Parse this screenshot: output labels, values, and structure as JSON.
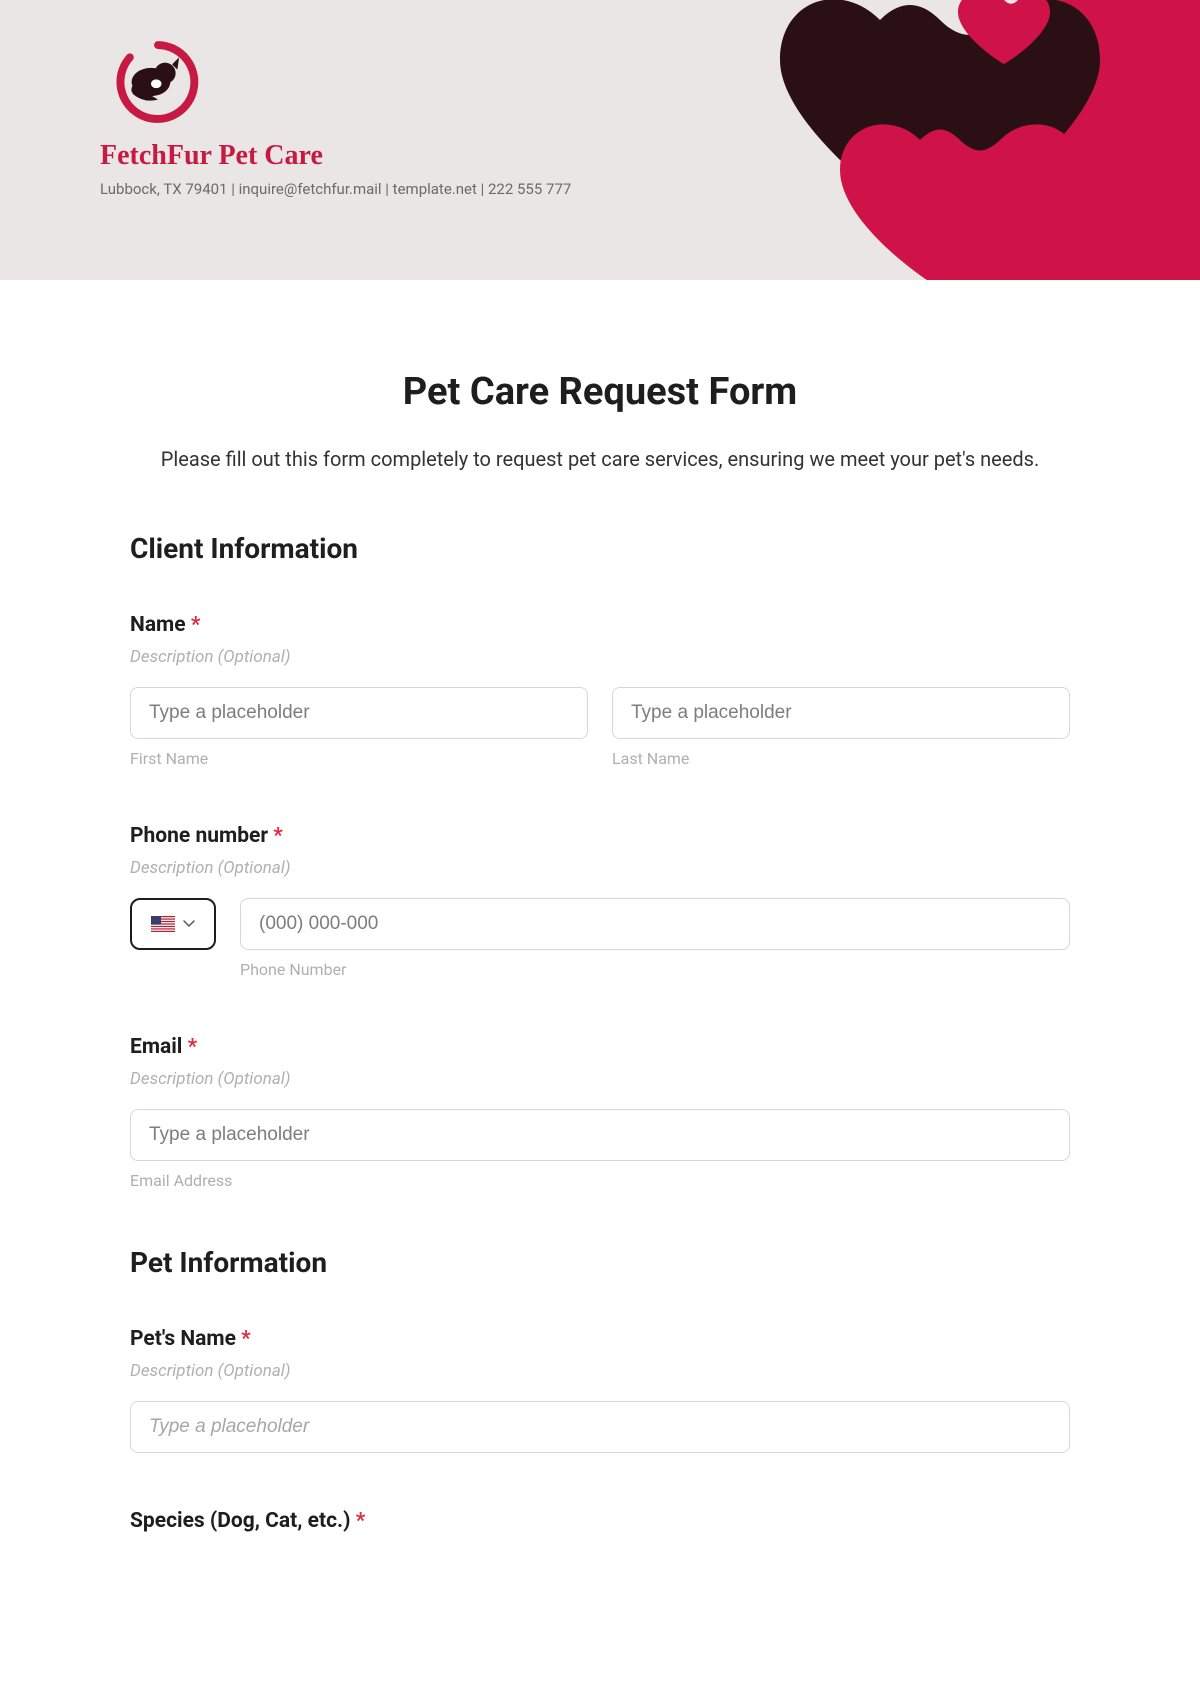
{
  "header": {
    "company_name": "FetchFur Pet Care",
    "company_info": "Lubbock, TX 79401 | inquire@fetchfur.mail | template.net | 222 555 777"
  },
  "form": {
    "title": "Pet Care Request Form",
    "intro": "Please fill out this form completely to request pet care services, ensuring we meet your pet's needs."
  },
  "sections": {
    "client": {
      "heading": "Client Information",
      "name": {
        "label": "Name",
        "required": "*",
        "desc": "Description (Optional)",
        "first_placeholder": "Type a placeholder",
        "last_placeholder": "Type a placeholder",
        "first_sub": "First Name",
        "last_sub": "Last Name"
      },
      "phone": {
        "label": "Phone number",
        "required": "*",
        "desc": "Description (Optional)",
        "placeholder": "(000) 000-000",
        "sub": "Phone Number"
      },
      "email": {
        "label": "Email",
        "required": "*",
        "desc": "Description (Optional)",
        "placeholder": "Type a placeholder",
        "sub": "Email Address"
      }
    },
    "pet": {
      "heading": "Pet Information",
      "name": {
        "label": "Pet's Name",
        "required": "*",
        "desc": "Description (Optional)",
        "placeholder": "Type a placeholder"
      },
      "species": {
        "label": "Species (Dog, Cat, etc.)",
        "required": "*"
      }
    }
  }
}
